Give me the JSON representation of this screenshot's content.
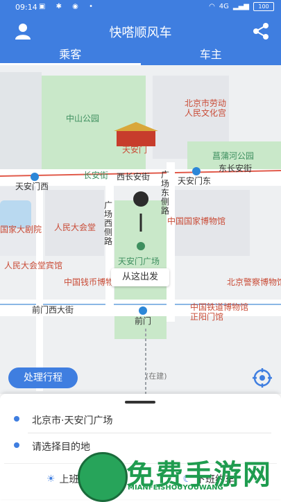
{
  "status_bar": {
    "time": "09:14",
    "network": "4G",
    "battery": "100"
  },
  "app_bar": {
    "title": "快嗒顺风车"
  },
  "tabs": [
    {
      "label": "乘客",
      "active": true
    },
    {
      "label": "车主",
      "active": false
    }
  ],
  "map": {
    "labels": {
      "zhongshan_park": "中山公园",
      "workers_palace": "北京市劳动人民文化宫",
      "tiananmen": "天安门",
      "changpuhe_park": "菖蒲河公园",
      "changan_street": "长安街",
      "west_changan": "西长安街",
      "east_changan": "东长安街",
      "tiananmen_west": "天安门西",
      "tiananmen_east": "天安门东",
      "square_east_road": "广场东侧路",
      "square_west_road": "广场西侧路",
      "grand_theater": "国家大剧院",
      "great_hall": "人民大会堂",
      "national_museum": "中国国家博物馆",
      "great_hall_hotel": "人民大会堂宾馆",
      "tiananmen_square": "天安门广场",
      "numismatic_museum": "中国钱币博物馆",
      "police_museum": "北京警察博物馆",
      "qianmen_west": "前门西大街",
      "qianmen": "前门",
      "railway_museum": "中国铁道博物馆正阳门馆",
      "under_construction": "(在建)"
    },
    "callout": "从这出发"
  },
  "buttons": {
    "process_trip": "处理行程"
  },
  "sheet": {
    "origin": "北京市·天安门广场",
    "destination_placeholder": "请选择目的地",
    "commute_to_work": "上班约车",
    "commute_home": "下班约车"
  },
  "watermark": {
    "title": "免费手游网",
    "subtitle": "MIANFEISHOUYOUWANG"
  },
  "colors": {
    "primary": "#3f7ee0",
    "park_green": "#c9e8c9",
    "poi_red": "#d05a3a"
  },
  "icons": [
    "user-icon",
    "share-icon",
    "locate-icon",
    "subway-icon",
    "museum-icon",
    "pin-icon",
    "sun-icon",
    "moon-icon"
  ]
}
